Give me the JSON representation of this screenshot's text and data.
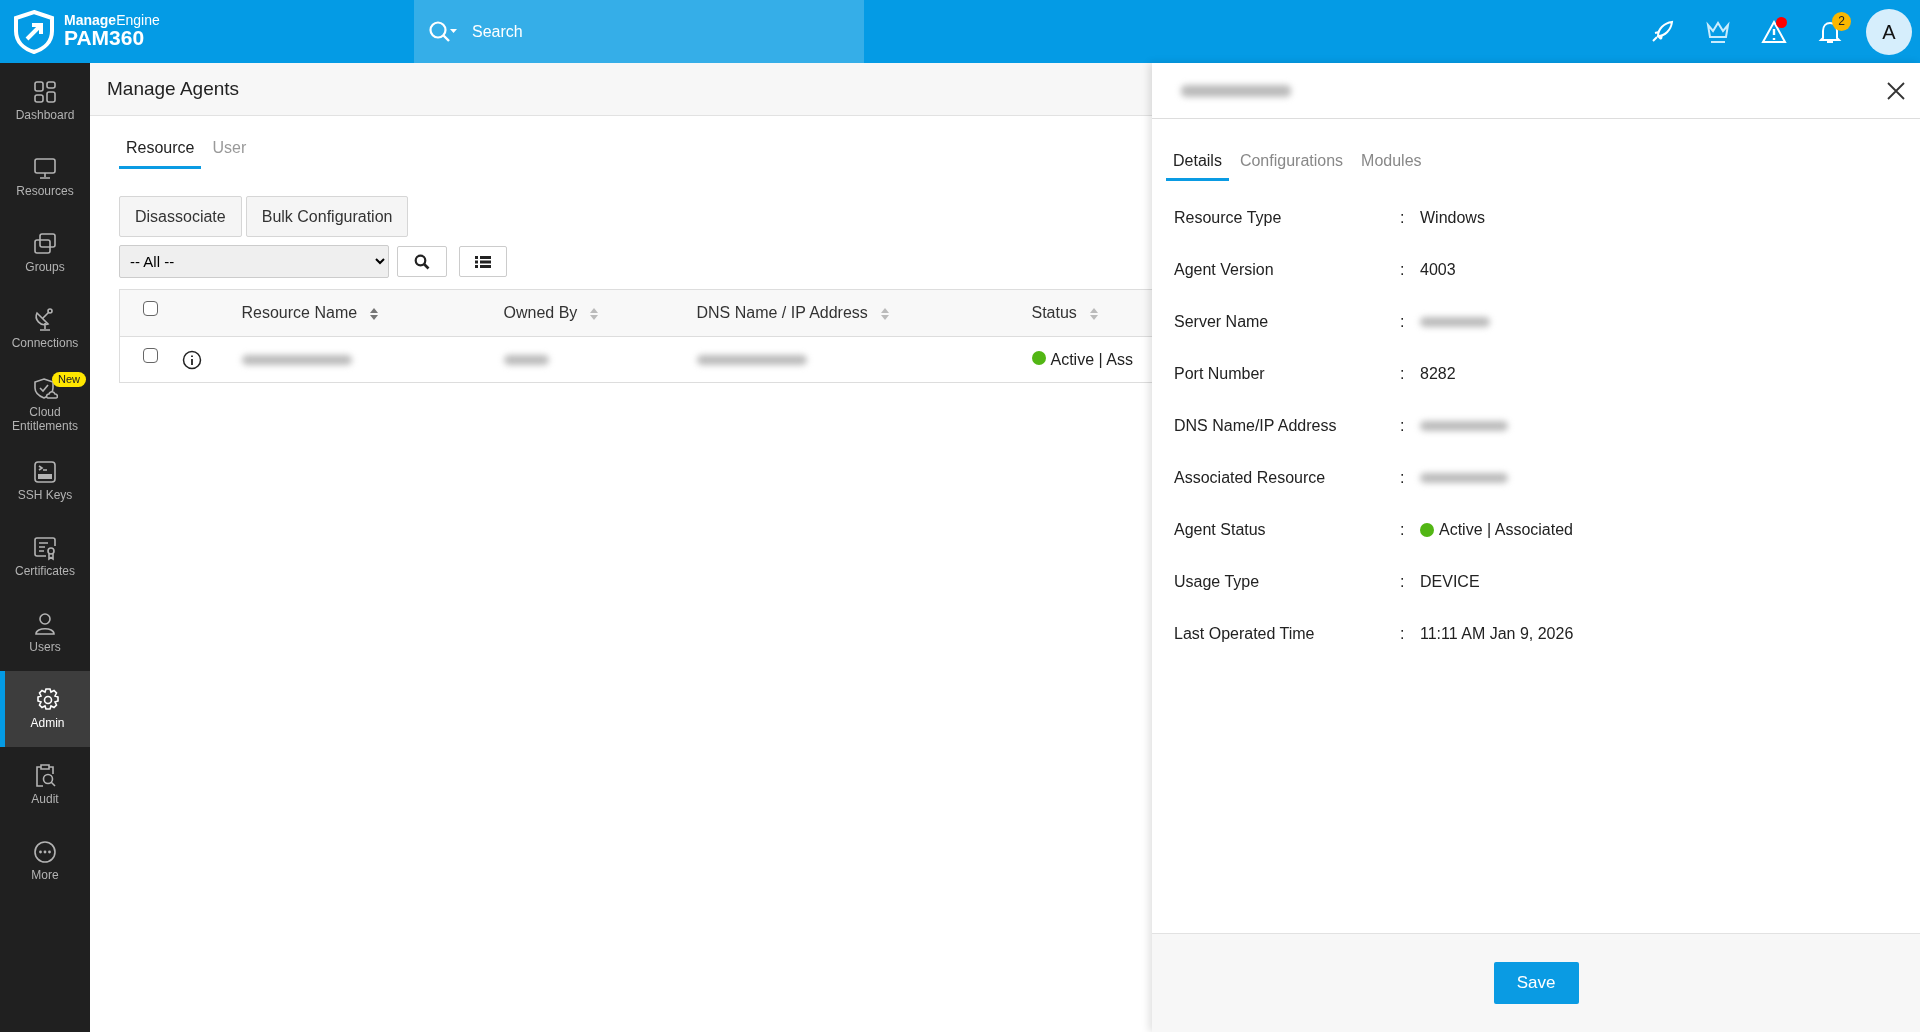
{
  "brand": {
    "vendor": "**Manage**Engine",
    "product": "PAM360"
  },
  "search": {
    "placeholder": "Search"
  },
  "topbar": {
    "alert_dot": true,
    "notifications": "2",
    "avatar": "A"
  },
  "sidebar": {
    "items": [
      {
        "label": "Dashboard",
        "selected": false
      },
      {
        "label": "Resources",
        "selected": false
      },
      {
        "label": "Groups",
        "selected": false
      },
      {
        "label": "Connections",
        "selected": false
      },
      {
        "label": "Cloud Entitlements",
        "selected": false,
        "badge": "New"
      },
      {
        "label": "SSH Keys",
        "selected": false
      },
      {
        "label": "Certificates",
        "selected": false
      },
      {
        "label": "Users",
        "selected": false
      },
      {
        "label": "Admin",
        "selected": true
      },
      {
        "label": "Audit",
        "selected": false
      },
      {
        "label": "More",
        "selected": false
      }
    ]
  },
  "page": {
    "title": "Manage Agents",
    "tabs": [
      {
        "label": "Resource",
        "selected": true
      },
      {
        "label": "User",
        "selected": false
      }
    ],
    "buttons": [
      "Disassociate",
      "Bulk Configuration"
    ],
    "filter": {
      "value": "-- All --"
    }
  },
  "table": {
    "columns": [
      "Resource Name",
      "Owned By",
      "DNS Name / IP Address",
      "Status"
    ],
    "header_checked": false,
    "rows": [
      {
        "checked": false,
        "status": "Active | Ass",
        "color": "#52b614"
      }
    ]
  },
  "panel": {
    "tabs": [
      {
        "label": "Details",
        "selected": true
      },
      {
        "label": "Configurations",
        "selected": false
      },
      {
        "label": "Modules",
        "selected": false
      }
    ],
    "details": [
      {
        "kind": "text",
        "label": "Resource Type",
        "value": "Windows"
      },
      {
        "kind": "text",
        "label": "Agent Version",
        "value": "4003"
      },
      {
        "kind": "redacted",
        "label": "Server Name"
      },
      {
        "kind": "text",
        "label": "Port Number",
        "value": "8282"
      },
      {
        "kind": "redacted",
        "label": "DNS Name/IP Address"
      },
      {
        "kind": "redacted",
        "label": "Associated Resource"
      },
      {
        "kind": "status",
        "label": "Agent Status",
        "value": "Active | Associated",
        "color": "#52b614"
      },
      {
        "kind": "text",
        "label": "Usage Type",
        "value": "DEVICE"
      },
      {
        "kind": "text",
        "label": "Last Operated Time",
        "value": "11:11 AM Jan 9, 2026"
      }
    ],
    "separator": ":",
    "save": "Save"
  }
}
